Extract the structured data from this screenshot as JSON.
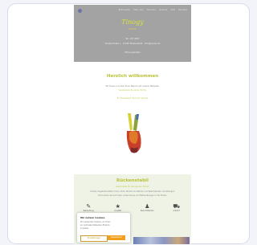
{
  "hero": {
    "nav": [
      "Startseite",
      "Über Uns",
      "Termine",
      "Galerie",
      "FAQ",
      "Kontakt"
    ],
    "brand_title": "Tinogy",
    "brand_sub": "Praxis",
    "lines": [
      "Tel. 123 4567",
      "Musterstraße 1 · 12345 Musterstadt · info@praxis.de",
      "Öffnungszeiten"
    ]
  },
  "welcome": {
    "title": "Herzlich willkommen",
    "lines": [
      "Wir freuen uns über Ihren Besuch auf unserer Webseite.",
      "Vereinbaren Sie einen Termin",
      "Ihr Praxisteam freut sich auf Sie"
    ]
  },
  "hand_icon": "peace-sign-hand-icon",
  "section2": {
    "title": "Rückenstabil",
    "subtitle": "Gesundheit für den ganzen Körper",
    "lines": [
      "Unsere Angebote helfen Ihnen, Ihren Rücken zu stärken und Beschwerden vorzubeugen.",
      "Informieren Sie sich über unsere Kurse und Behandlungen in der Praxis."
    ]
  },
  "icons": [
    {
      "icon": "tool-icon",
      "caption": "Behandlung"
    },
    {
      "icon": "star-icon",
      "caption": "Qualität"
    },
    {
      "icon": "user-plus-icon",
      "caption": "Neue Patienten"
    },
    {
      "icon": "car-icon",
      "caption": "Anfahrt"
    }
  ],
  "cookie": {
    "title": "Wir nutzen Cookies",
    "lines": [
      "Wir verwenden Cookies, um Ihnen",
      "ein optimales Webseiten-Erlebnis",
      "zu bieten."
    ],
    "settings_label": "Einstellungen",
    "accept_label": "Akzeptieren"
  }
}
